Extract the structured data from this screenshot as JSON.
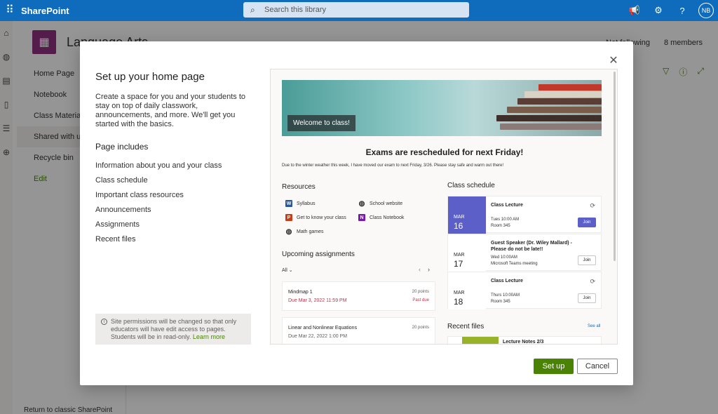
{
  "suite": {
    "waffle_icon": "waffle-icon",
    "brand": "SharePoint",
    "search_placeholder": "Search this library",
    "avatar_initials": "NB"
  },
  "site": {
    "title": "Language Arts",
    "following": "Not following",
    "members": "8 members"
  },
  "leftnav": {
    "items": [
      {
        "label": "Home Page"
      },
      {
        "label": "Notebook"
      },
      {
        "label": "Class Materials"
      },
      {
        "label": "Shared with us"
      },
      {
        "label": "Recycle bin"
      },
      {
        "label": "Edit"
      }
    ],
    "footer": "Return to classic SharePoint"
  },
  "dialog": {
    "title": "Set up your home page",
    "description": "Create a space for you and your students to stay on top of daily classwork, announcements, and more. We'll get you started with the basics.",
    "includes_heading": "Page includes",
    "includes": [
      "Information about you and your class",
      "Class schedule",
      "Important class resources",
      "Announcements",
      "Assignments",
      "Recent files"
    ],
    "notice_text": "Site permissions will be changed so that only educators will have edit access to pages. Students will be in read-only.",
    "notice_link": "Learn more",
    "setup_label": "Set up",
    "cancel_label": "Cancel"
  },
  "preview": {
    "hero_label": "Welcome to class!",
    "headline": "Exams are rescheduled for next Friday!",
    "subline": "Due to the winter weather this week, I have moved our exam to next Friday, 3/26. Please stay safe and warm out there!",
    "resources_heading": "Resources",
    "resources": [
      {
        "label": "Syllabus",
        "icon": "word-icon",
        "color": "#2b579a"
      },
      {
        "label": "School website",
        "icon": "globe-icon",
        "color": "#323130"
      },
      {
        "label": "Get to know your class",
        "icon": "powerpoint-icon",
        "color": "#c43e1c"
      },
      {
        "label": "Class Notebook",
        "icon": "onenote-icon",
        "color": "#7719aa"
      },
      {
        "label": "Math games",
        "icon": "globe-icon",
        "color": "#323130"
      }
    ],
    "assignments_heading": "Upcoming assignments",
    "filter": "All",
    "assignments": [
      {
        "name": "Mindmap 1",
        "due": "Due Mar 3, 2022 11:59 PM",
        "points": "20 points",
        "status": "Past due"
      },
      {
        "name": "Linear and Nonlinear Equations",
        "due": "Due Mar 22, 2022 1:00 PM",
        "points": "20 points",
        "status": ""
      }
    ],
    "schedule_heading": "Class schedule",
    "schedule": [
      {
        "month": "MAR",
        "day": "16",
        "title": "Class Lecture",
        "time": "Tues 10:00 AM",
        "place": "Room 345",
        "join": "Join"
      },
      {
        "month": "MAR",
        "day": "17",
        "title": "Guest Speaker (Dr. Wiley Mallard) - Please do not be late!!",
        "time": "Wed 10:00AM",
        "place": "Microsoft Teams meeting",
        "join": "Join"
      },
      {
        "month": "MAR",
        "day": "18",
        "title": "Class Lecture",
        "time": "Thurs 10:00AM",
        "place": "Room 345",
        "join": "Join"
      }
    ],
    "recent_heading": "Recent files",
    "see_all": "See all",
    "recent_file": "Lecture Notes 2/3"
  },
  "colors": {
    "suite_blue": "#0f6cbd",
    "primary_green": "#498205",
    "teams_purple": "#5b5fc7",
    "past_due_red": "#c4314b"
  }
}
